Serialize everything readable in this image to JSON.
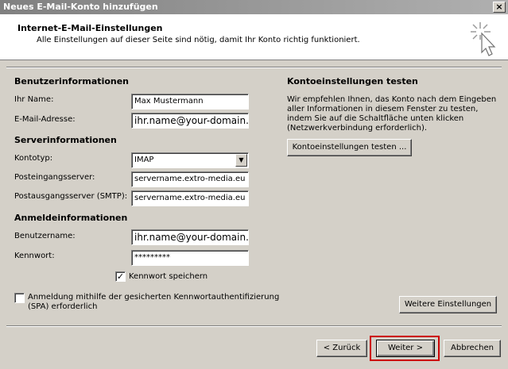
{
  "window": {
    "title": "Neues E-Mail-Konto hinzufügen"
  },
  "header": {
    "title": "Internet-E-Mail-Einstellungen",
    "subtitle": "Alle Einstellungen auf dieser Seite sind nötig, damit Ihr Konto richtig funktioniert."
  },
  "user_info": {
    "heading": "Benutzerinformationen",
    "name_label": "Ihr Name:",
    "name_value": "Max Mustermann",
    "email_label": "E-Mail-Adresse:",
    "email_value": "ihr.name@your-domain.co"
  },
  "server_info": {
    "heading": "Serverinformationen",
    "type_label": "Kontotyp:",
    "type_value": "IMAP",
    "incoming_label": "Posteingangsserver:",
    "incoming_value": "servername.extro-media.eu",
    "outgoing_label": "Postausgangsserver (SMTP):",
    "outgoing_value": "servername.extro-media.eu"
  },
  "login_info": {
    "heading": "Anmeldeinformationen",
    "user_label": "Benutzername:",
    "user_value": "ihr.name@your-domain.co",
    "pass_label": "Kennwort:",
    "pass_value": "*********",
    "save_pass_label": "Kennwort speichern",
    "save_pass_checked": true,
    "spa_label": "Anmeldung mithilfe der gesicherten Kennwortauthentifizierung (SPA) erforderlich",
    "spa_checked": false
  },
  "test": {
    "heading": "Kontoeinstellungen testen",
    "text": "Wir empfehlen Ihnen, das Konto nach dem Eingeben aller Informationen in diesem Fenster zu testen, indem Sie auf die Schaltfläche unten klicken (Netzwerkverbindung erforderlich).",
    "button": "Kontoeinstellungen testen ..."
  },
  "more_settings_button": "Weitere Einstellungen",
  "footer": {
    "back": "< Zurück",
    "next": "Weiter >",
    "cancel": "Abbrechen"
  },
  "colors": {
    "highlight": "#cc0000",
    "background": "#d4d0c8"
  }
}
